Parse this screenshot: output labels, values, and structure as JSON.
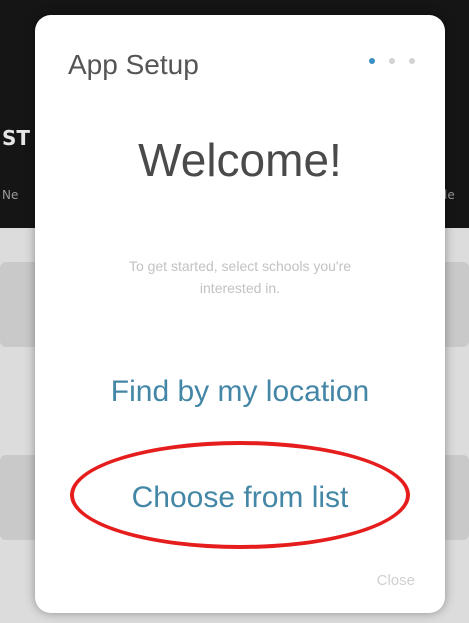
{
  "background": {
    "fragment_top": "ST",
    "fragment_left": "Ne",
    "fragment_right": "le"
  },
  "modal": {
    "title": "App Setup",
    "pager": {
      "total": 3,
      "active_index": 0,
      "active_color": "#3a8fc4"
    },
    "heading": "Welcome!",
    "subtitle": "To get started, select schools you're interested in.",
    "find_by_location_label": "Find by my location",
    "choose_from_list_label": "Choose from list",
    "close_label": "Close"
  },
  "annotation": {
    "highlight_color": "#e61d1d",
    "highlight_target": "Choose from list"
  }
}
